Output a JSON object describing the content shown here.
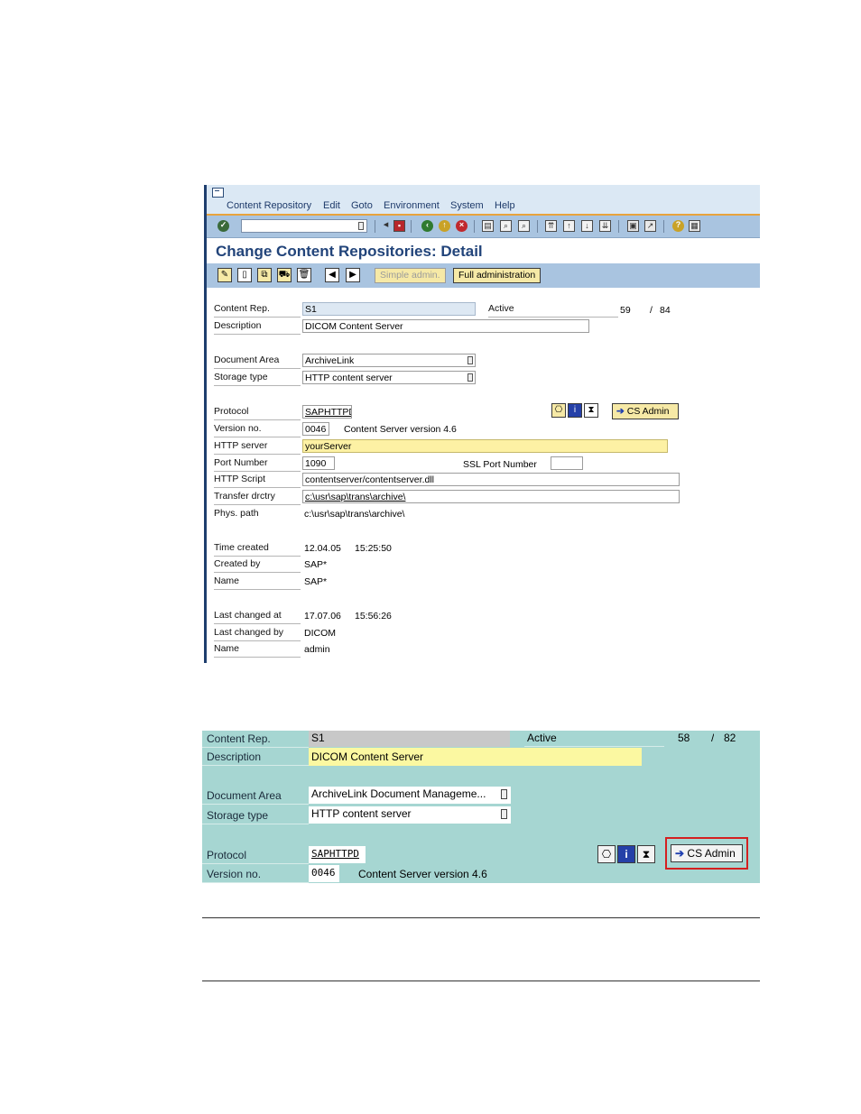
{
  "sap_window": {
    "menu": [
      {
        "label": "Content Repository"
      },
      {
        "label": "Edit"
      },
      {
        "label": "Goto"
      },
      {
        "label": "Environment"
      },
      {
        "label": "System"
      },
      {
        "label": "Help"
      }
    ],
    "title": "Change Content Repositories: Detail",
    "app_toolbar": {
      "simple_admin": "Simple admin.",
      "full_admin": "Full administration"
    },
    "form": {
      "content_rep_label": "Content Rep.",
      "content_rep_value": "S1",
      "active_label": "Active",
      "active_count": "59",
      "slash": "/",
      "active_total": "84",
      "description_label": "Description",
      "description_value": "DICOM Content Server",
      "document_area_label": "Document Area",
      "document_area_value": "ArchiveLink",
      "storage_type_label": "Storage type",
      "storage_type_value": "HTTP content server",
      "protocol_label": "Protocol",
      "protocol_value": "SAPHTTPD",
      "cs_admin_label": "CS Admin",
      "version_label": "Version no.",
      "version_value": "0046",
      "version_text": "Content Server version 4.6",
      "http_server_label": "HTTP server",
      "http_server_value": "yourServer",
      "port_label": "Port Number",
      "port_value": "1090",
      "ssl_port_label": "SSL Port Number",
      "http_script_label": "HTTP Script",
      "http_script_value": "contentserver/contentserver.dll",
      "transfer_label": "Transfer drctry",
      "transfer_value": "c:\\usr\\sap\\trans\\archive\\",
      "phys_label": "Phys. path",
      "phys_value": "c:\\usr\\sap\\trans\\archive\\",
      "time_created_label": "Time created",
      "time_created_date": "12.04.05",
      "time_created_time": "15:25:50",
      "created_by_label": "Created by",
      "created_by_value": "SAP*",
      "name1_label": "Name",
      "name1_value": "SAP*",
      "last_changed_label": "Last changed at",
      "last_changed_date": "17.07.06",
      "last_changed_time": "15:56:26",
      "last_changed_by_label": "Last changed by",
      "last_changed_by_value": "DICOM",
      "name2_label": "Name",
      "name2_value": "admin"
    }
  },
  "zoom_detail": {
    "content_rep_label": "Content Rep.",
    "content_rep_value": "S1",
    "active_label": "Active",
    "active_count": "58",
    "slash": "/",
    "active_total": "82",
    "description_label": "Description",
    "description_value": "DICOM Content Server",
    "document_area_label": "Document Area",
    "document_area_value": "ArchiveLink Document Manageme...",
    "storage_type_label": "Storage type",
    "storage_type_value": "HTTP content server",
    "protocol_label": "Protocol",
    "protocol_value": "SAPHTTPD",
    "cs_admin_label": "CS Admin",
    "version_label": "Version no.",
    "version_value": "0046",
    "version_text": "Content Server version 4.6"
  },
  "colors": {
    "sap_blue": "#a9c4e0",
    "title_blue": "#22447a",
    "button_yellow": "#f6e9a6",
    "field_yellow": "#fdf1a4",
    "zoom_teal": "#a6d6d2",
    "highlight_red": "#d42020"
  }
}
